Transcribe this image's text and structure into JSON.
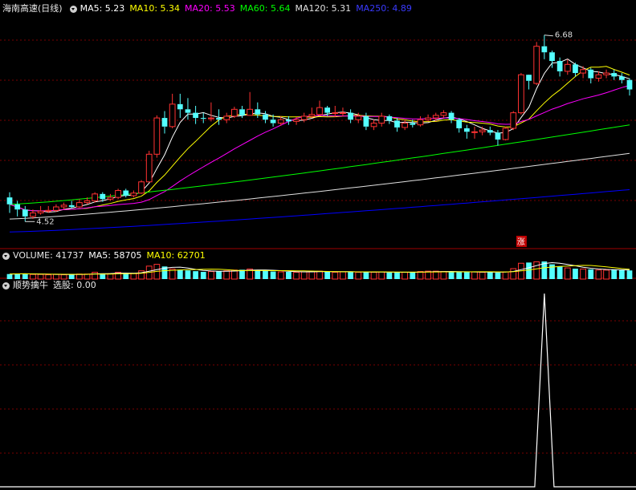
{
  "title": "海南高速(日线)",
  "price_panel": {
    "indicators": [
      {
        "label": "MA5: 5.23",
        "color": "#ffffff"
      },
      {
        "label": "MA10: 5.34",
        "color": "#ffff00"
      },
      {
        "label": "MA20: 5.53",
        "color": "#ff00ff"
      },
      {
        "label": "MA60: 5.64",
        "color": "#00ff00"
      },
      {
        "label": "MA120: 5.31",
        "color": "#e0e0e0"
      },
      {
        "label": "MA250: 4.89",
        "color": "#0000ff"
      }
    ]
  },
  "volume_panel": {
    "label": "VOLUME: 41737",
    "indicators": [
      {
        "label": "MA5: 58705",
        "color": "#ffffff"
      },
      {
        "label": "MA10: 62701",
        "color": "#ffff00"
      }
    ]
  },
  "indicator_panel": {
    "label": "顺势擒牛",
    "value_label": "选股: 0.00"
  },
  "annotations": {
    "high_label": "6.68",
    "low_label": "4.52",
    "limit_up_marker": "涨"
  },
  "chart_data": {
    "type": "candlestick",
    "y_range": [
      4.3,
      6.9
    ],
    "candles": [
      [
        4.8,
        4.72,
        4.86,
        4.62
      ],
      [
        4.72,
        4.66,
        4.76,
        4.58
      ],
      [
        4.66,
        4.58,
        4.7,
        4.52
      ],
      [
        4.58,
        4.62,
        4.66,
        4.55
      ],
      [
        4.62,
        4.64,
        4.7,
        4.6
      ],
      [
        4.64,
        4.65,
        4.7,
        4.62
      ],
      [
        4.65,
        4.69,
        4.72,
        4.63
      ],
      [
        4.69,
        4.71,
        4.74,
        4.66
      ],
      [
        4.71,
        4.69,
        4.76,
        4.67
      ],
      [
        4.69,
        4.74,
        4.78,
        4.68
      ],
      [
        4.74,
        4.76,
        4.8,
        4.72
      ],
      [
        4.76,
        4.84,
        4.86,
        4.74
      ],
      [
        4.84,
        4.78,
        4.86,
        4.75
      ],
      [
        4.78,
        4.8,
        4.84,
        4.76
      ],
      [
        4.8,
        4.88,
        4.9,
        4.78
      ],
      [
        4.88,
        4.82,
        4.9,
        4.8
      ],
      [
        4.82,
        4.85,
        4.88,
        4.8
      ],
      [
        4.85,
        4.98,
        5.0,
        4.84
      ],
      [
        4.98,
        5.3,
        5.34,
        4.98
      ],
      [
        5.3,
        5.72,
        5.75,
        5.26
      ],
      [
        5.72,
        5.62,
        5.8,
        5.54
      ],
      [
        5.62,
        5.88,
        6.0,
        5.6
      ],
      [
        5.88,
        5.82,
        6.0,
        5.72
      ],
      [
        5.82,
        5.78,
        5.95,
        5.7
      ],
      [
        5.78,
        5.72,
        5.86,
        5.65
      ],
      [
        5.72,
        5.71,
        5.78,
        5.66
      ],
      [
        5.71,
        5.72,
        5.9,
        5.68
      ],
      [
        5.72,
        5.7,
        5.82,
        5.64
      ],
      [
        5.7,
        5.74,
        5.78,
        5.66
      ],
      [
        5.74,
        5.82,
        5.85,
        5.72
      ],
      [
        5.82,
        5.75,
        5.86,
        5.72
      ],
      [
        5.75,
        5.82,
        6.02,
        5.76
      ],
      [
        5.82,
        5.76,
        5.9,
        5.72
      ],
      [
        5.76,
        5.7,
        5.8,
        5.66
      ],
      [
        5.7,
        5.66,
        5.76,
        5.62
      ],
      [
        5.66,
        5.7,
        5.74,
        5.63
      ],
      [
        5.7,
        5.68,
        5.74,
        5.64
      ],
      [
        5.68,
        5.7,
        5.73,
        5.64
      ],
      [
        5.7,
        5.74,
        5.78,
        5.67
      ],
      [
        5.74,
        5.76,
        5.84,
        5.72
      ],
      [
        5.76,
        5.84,
        5.92,
        5.74
      ],
      [
        5.84,
        5.78,
        5.86,
        5.74
      ],
      [
        5.78,
        5.78,
        5.86,
        5.73
      ],
      [
        5.78,
        5.78,
        5.84,
        5.74
      ],
      [
        5.78,
        5.7,
        5.82,
        5.66
      ],
      [
        5.7,
        5.74,
        5.78,
        5.66
      ],
      [
        5.74,
        5.62,
        5.78,
        5.58
      ],
      [
        5.62,
        5.66,
        5.7,
        5.58
      ],
      [
        5.66,
        5.74,
        5.78,
        5.62
      ],
      [
        5.74,
        5.69,
        5.76,
        5.65
      ],
      [
        5.69,
        5.61,
        5.72,
        5.56
      ],
      [
        5.61,
        5.66,
        5.7,
        5.58
      ],
      [
        5.66,
        5.64,
        5.7,
        5.61
      ],
      [
        5.64,
        5.7,
        5.74,
        5.62
      ],
      [
        5.7,
        5.72,
        5.76,
        5.68
      ],
      [
        5.72,
        5.75,
        5.78,
        5.68
      ],
      [
        5.75,
        5.78,
        5.81,
        5.72
      ],
      [
        5.78,
        5.7,
        5.8,
        5.66
      ],
      [
        5.7,
        5.6,
        5.72,
        5.55
      ],
      [
        5.6,
        5.56,
        5.64,
        5.48
      ],
      [
        5.56,
        5.56,
        5.62,
        5.48
      ],
      [
        5.56,
        5.58,
        5.62,
        5.52
      ],
      [
        5.58,
        5.55,
        5.62,
        5.52
      ],
      [
        5.55,
        5.47,
        5.58,
        5.4
      ],
      [
        5.47,
        5.6,
        5.62,
        5.46
      ],
      [
        5.6,
        5.78,
        5.8,
        5.58
      ],
      [
        5.78,
        6.22,
        6.24,
        5.76
      ],
      [
        6.22,
        6.15,
        6.2,
        6.05
      ],
      [
        6.12,
        6.55,
        6.6,
        6.1
      ],
      [
        6.55,
        6.48,
        6.68,
        6.4
      ],
      [
        6.48,
        6.38,
        6.5,
        6.3
      ],
      [
        6.38,
        6.26,
        6.42,
        6.2
      ],
      [
        6.26,
        6.34,
        6.4,
        6.22
      ],
      [
        6.34,
        6.24,
        6.36,
        6.2
      ],
      [
        6.24,
        6.28,
        6.32,
        6.18
      ],
      [
        6.28,
        6.18,
        6.3,
        6.12
      ],
      [
        6.18,
        6.22,
        6.26,
        6.14
      ],
      [
        6.22,
        6.24,
        6.28,
        6.18
      ],
      [
        6.24,
        6.2,
        6.28,
        6.16
      ],
      [
        6.2,
        6.16,
        6.24,
        6.12
      ],
      [
        6.16,
        6.05,
        6.18,
        5.98
      ]
    ],
    "volume": [
      28,
      30,
      30,
      26,
      26,
      24,
      26,
      24,
      26,
      28,
      28,
      38,
      30,
      30,
      38,
      30,
      32,
      46,
      72,
      82,
      70,
      56,
      52,
      48,
      44,
      40,
      42,
      44,
      46,
      50,
      52,
      56,
      50,
      46,
      42,
      40,
      40,
      38,
      40,
      42,
      44,
      42,
      38,
      40,
      40,
      38,
      40,
      38,
      40,
      36,
      38,
      38,
      38,
      42,
      44,
      44,
      42,
      40,
      38,
      38,
      40,
      38,
      40,
      36,
      40,
      58,
      88,
      92,
      96,
      98,
      82,
      70,
      62,
      58,
      56,
      54,
      50,
      50,
      52,
      50,
      48
    ],
    "signal": {
      "index": 69,
      "value": 1.0
    }
  }
}
